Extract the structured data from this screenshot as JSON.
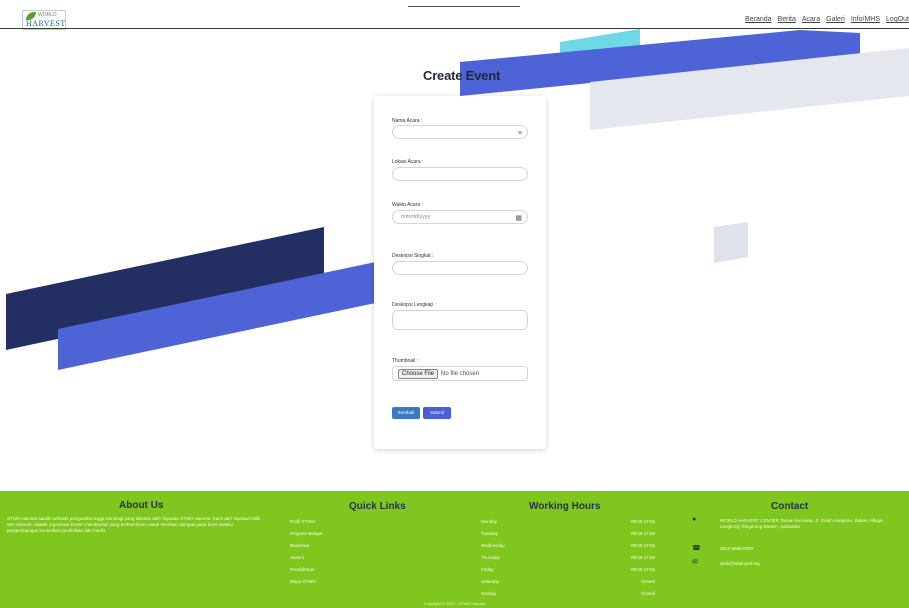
{
  "header": {
    "logo_text": "HARVEST",
    "logo_top": "WORLD",
    "nav": [
      "Beranda",
      "Berita",
      "Acara",
      "Galeri",
      "Info/MHS",
      "LogOut"
    ]
  },
  "page": {
    "title": "Create Event"
  },
  "form": {
    "nama_label": "Nama Acara :",
    "lokasi_label": "Lokasi Acara :",
    "waktu_label": "Waktu Acara :",
    "waktu_placeholder": "mm/dd/yyyy",
    "desk_singkat_label": "Deskripsi Singkat :",
    "desk_lengkap_label": "Deskripsi Lengkap :",
    "thumbnail_label": "Thumbnail :",
    "file_button": "Choose File",
    "file_status": "No file chosen",
    "back_button": "Kembali",
    "submit_button": "Submit"
  },
  "footer": {
    "about_title": "About Us",
    "about_text": "STWH Harvest adalah sekolah pengusaha tinggi teknologi yang dikelola oleh Yayasan STWH Harvest. Kami dari Yayasan milik WH Harvest. Adalah organisasi kristen membentuk yang berkomitmen untuk memberi dampak pada bumi melalui pengembangan komunitas pendidikan dan media.",
    "links_title": "Quick Links",
    "links": [
      "Profil STWH",
      "Program Belajar",
      "Beasiswa",
      "Alumni",
      "Pendaftaran",
      "Biaya STWH"
    ],
    "hours_title": "Working Hours",
    "days": [
      "Monday",
      "Tuesday",
      "Wednesday",
      "Thursday",
      "Friday",
      "Saturday",
      "Sunday"
    ],
    "hours": [
      "08:00-17:00",
      "08:00-17:00",
      "08:00-17:00",
      "08:00-17:00",
      "08:00-17:00",
      "Closed",
      "Closed"
    ],
    "contact_title": "Contact",
    "address": "WORLD HARVEST CENTER Taman Kencana, Jl. Galuh Kanjuran, Bataru Village, Lengkong Tangerang Banten, Indonesia",
    "phone": "0813-9696-0000",
    "email": "stwh@wharvest.org",
    "copyright": "Copyright © 2023 - STWH Harvest"
  },
  "colors": {
    "footer_bg": "#7fc61e",
    "navy": "#232f63",
    "blue": "#4e63d6",
    "cyan": "#6fd8e8"
  }
}
